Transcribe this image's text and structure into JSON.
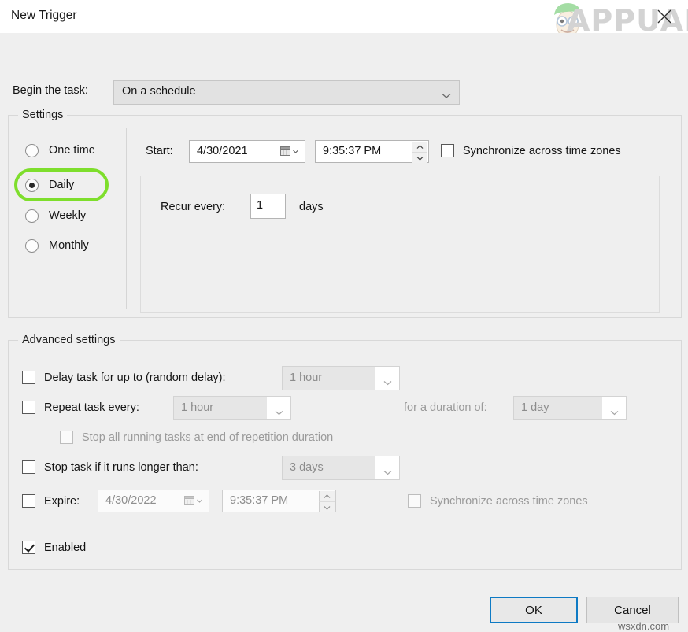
{
  "window": {
    "title": "New Trigger",
    "close_icon": "close-icon"
  },
  "watermark": {
    "logo_text": "APPUALS",
    "footer_text": "wsxdn.com"
  },
  "begin": {
    "label": "Begin the task:",
    "value": "On a schedule",
    "arrow_icon": "chevron-down-icon"
  },
  "settings": {
    "group_title": "Settings",
    "schedule_options": [
      {
        "label": "One time",
        "checked": false
      },
      {
        "label": "Daily",
        "checked": true
      },
      {
        "label": "Weekly",
        "checked": false
      },
      {
        "label": "Monthly",
        "checked": false
      }
    ],
    "start": {
      "label": "Start:",
      "date": "4/30/2021",
      "time": "9:35:37 PM",
      "calendar_icon": "calendar-icon",
      "spinner_icon": "spinner-up-down-icon"
    },
    "sync_timezones": {
      "label": "Synchronize across time zones",
      "checked": false
    },
    "recurrence": {
      "label": "Recur every:",
      "value": "1",
      "unit": "days"
    }
  },
  "advanced": {
    "group_title": "Advanced settings",
    "delay_task": {
      "label": "Delay task for up to (random delay):",
      "checked": false,
      "value": "1 hour"
    },
    "repeat_task": {
      "label": "Repeat task every:",
      "checked": false,
      "value": "1 hour",
      "duration_label": "for a duration of:",
      "duration_value": "1 day"
    },
    "stop_all_running": {
      "label": "Stop all running tasks at end of repetition duration",
      "checked": false
    },
    "stop_if_longer": {
      "label": "Stop task if it runs longer than:",
      "checked": false,
      "value": "3 days"
    },
    "expire": {
      "label": "Expire:",
      "checked": false,
      "date": "4/30/2022",
      "time": "9:35:37 PM",
      "sync_label": "Synchronize across time zones",
      "sync_checked": false
    },
    "enabled": {
      "label": "Enabled",
      "checked": true
    }
  },
  "footer": {
    "ok_label": "OK",
    "cancel_label": "Cancel"
  },
  "annotation": {
    "highlight_color": "#7ede2c",
    "target": "Daily"
  }
}
